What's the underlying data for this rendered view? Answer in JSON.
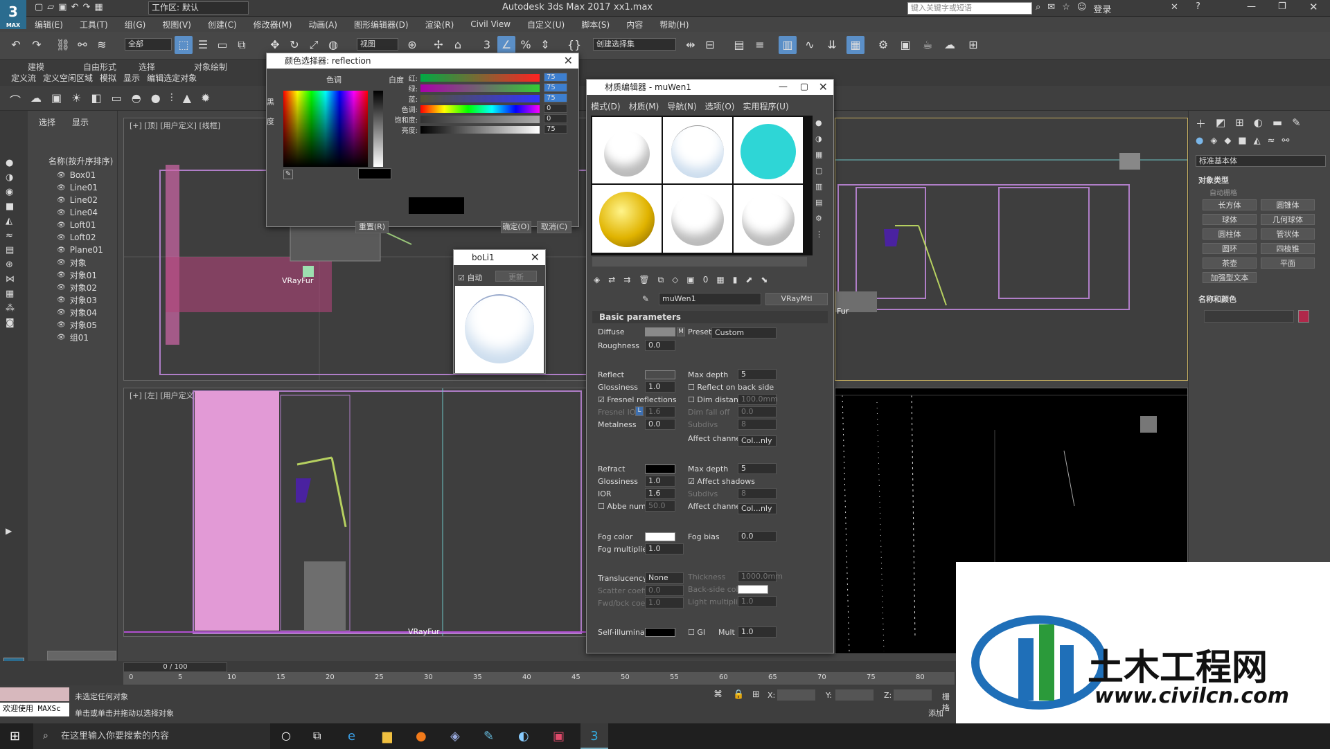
{
  "titlebar": {
    "app_title": "Autodesk 3ds Max 2017",
    "file_name": "xx1.max",
    "workspace": "工作区: 默认",
    "search_placeholder": "键入关键字或短语",
    "login": "登录"
  },
  "menu": [
    "编辑(E)",
    "工具(T)",
    "组(G)",
    "视图(V)",
    "创建(C)",
    "修改器(M)",
    "动画(A)",
    "图形编辑器(D)",
    "渲染(R)",
    "Civil View",
    "自定义(U)",
    "脚本(S)",
    "内容",
    "帮助(H)"
  ],
  "toolbar": {
    "filter": "全部",
    "view_dropdown": "视图",
    "selection_set": "创建选择集"
  },
  "ribbon": {
    "tabs": [
      "建模",
      "自由形式",
      "选择",
      "对象绘制"
    ],
    "subtabs": [
      "定义流",
      "定义空闲区域",
      "模拟",
      "显示",
      "编辑选定对象"
    ]
  },
  "scene_explorer": {
    "tab_select": "选择",
    "tab_display": "显示",
    "header": "名称(按升序排序)",
    "items": [
      "Box01",
      "Line01",
      "Line02",
      "Line04",
      "Loft01",
      "Loft02",
      "Plane01",
      "对象",
      "对象01",
      "对象02",
      "对象03",
      "对象04",
      "对象05",
      "组01"
    ]
  },
  "viewports": {
    "top": "[+] [顶] [用户定义] [线框]",
    "left": "[+] [左] [用户定义] [线框]",
    "fur_label_top": "VRayFur",
    "fur_label_left": "VRayFur",
    "fur_label_persp": "Fur"
  },
  "color_picker": {
    "title": "颜色选择器: reflection",
    "hue_label": "色调",
    "white_label": "白度",
    "black_label": "黑",
    "degree_label": "度",
    "channels": [
      {
        "label": "红:",
        "value": "75"
      },
      {
        "label": "绿:",
        "value": "75"
      },
      {
        "label": "蓝:",
        "value": "75"
      },
      {
        "label": "色调:",
        "value": "0"
      },
      {
        "label": "饱和度:",
        "value": "0"
      },
      {
        "label": "亮度:",
        "value": "75"
      }
    ],
    "reset": "重置(R)",
    "ok": "确定(O)",
    "cancel": "取消(C)"
  },
  "boli_window": {
    "title": "boLi1",
    "auto": "自动",
    "update": "更新"
  },
  "material_editor": {
    "title": "材质编辑器 - muWen1",
    "menu": [
      "模式(D)",
      "材质(M)",
      "导航(N)",
      "选项(O)",
      "实用程序(U)"
    ],
    "mat_name": "muWen1",
    "mat_type": "VRayMtl",
    "section": "Basic parameters",
    "diffuse": "Diffuse",
    "diffuse_map": "M",
    "preset_label": "Preset",
    "preset": "Custom",
    "roughness": "Roughness",
    "roughness_val": "0.0",
    "reflect": "Reflect",
    "max_depth": "Max depth",
    "max_depth_val": "5",
    "glossiness": "Glossiness",
    "glossiness_val": "1.0",
    "reflect_back": "Reflect on back side",
    "fresnel": "Fresnel reflections",
    "dim_distance": "Dim distance",
    "dim_distance_val": "100.0mm",
    "fresnel_ior": "Fresnel IOR",
    "fresnel_lock": "L",
    "fresnel_ior_val": "1.6",
    "dim_falloff": "Dim fall off",
    "dim_falloff_val": "0.0",
    "metalness": "Metalness",
    "metalness_val": "0.0",
    "subdivs": "Subdivs",
    "subdivs_val": "8",
    "affect_channels": "Affect channels",
    "affect_channels_val": "Col...nly",
    "refract": "Refract",
    "refract_max_depth_val": "5",
    "refract_gloss_val": "1.0",
    "affect_shadows": "Affect shadows",
    "ior": "IOR",
    "ior_val": "1.6",
    "refract_subdivs_val": "8",
    "abbe": "Abbe number",
    "abbe_val": "50.0",
    "fog_color": "Fog color",
    "fog_bias": "Fog bias",
    "fog_bias_val": "0.0",
    "fog_mult": "Fog multiplier",
    "fog_mult_val": "1.0",
    "translucency": "Translucency",
    "translucency_val": "None",
    "thickness": "Thickness",
    "thickness_val": "1000.0mm",
    "scatter": "Scatter coeff",
    "scatter_val": "0.0",
    "backside": "Back-side color",
    "fwd_bck": "Fwd/bck coeff",
    "fwd_bck_val": "1.0",
    "light_mult": "Light multiplier",
    "light_mult_val": "1.0",
    "self_illum": "Self-illumination",
    "gi": "GI",
    "mult": "Mult",
    "mult_val": "1.0"
  },
  "command_panel": {
    "category": "标准基本体",
    "section_type": "对象类型",
    "autogrid": "自动栅格",
    "buttons": [
      "长方体",
      "圆锥体",
      "球体",
      "几何球体",
      "圆柱体",
      "管状体",
      "圆环",
      "四棱锥",
      "茶壶",
      "平面",
      "加强型文本"
    ],
    "section_name": "名称和颜色"
  },
  "timeline": {
    "frame": "0 / 100",
    "ticks": [
      "0",
      "5",
      "10",
      "15",
      "20",
      "25",
      "30",
      "35",
      "40",
      "45",
      "50",
      "55",
      "60",
      "65",
      "70",
      "75",
      "80"
    ]
  },
  "status": {
    "welcome": "欢迎使用 MAXSc",
    "line1": "未选定任何对象",
    "line2": "单击或单击并拖动以选择对象",
    "x": "X:",
    "y": "Y:",
    "z": "Z:",
    "grid": "栅格",
    "add": "添加"
  },
  "taskbar": {
    "search": "在这里输入你要搜索的内容"
  },
  "watermark": {
    "name": "土木工程网",
    "url": "www.civilcn.com"
  }
}
